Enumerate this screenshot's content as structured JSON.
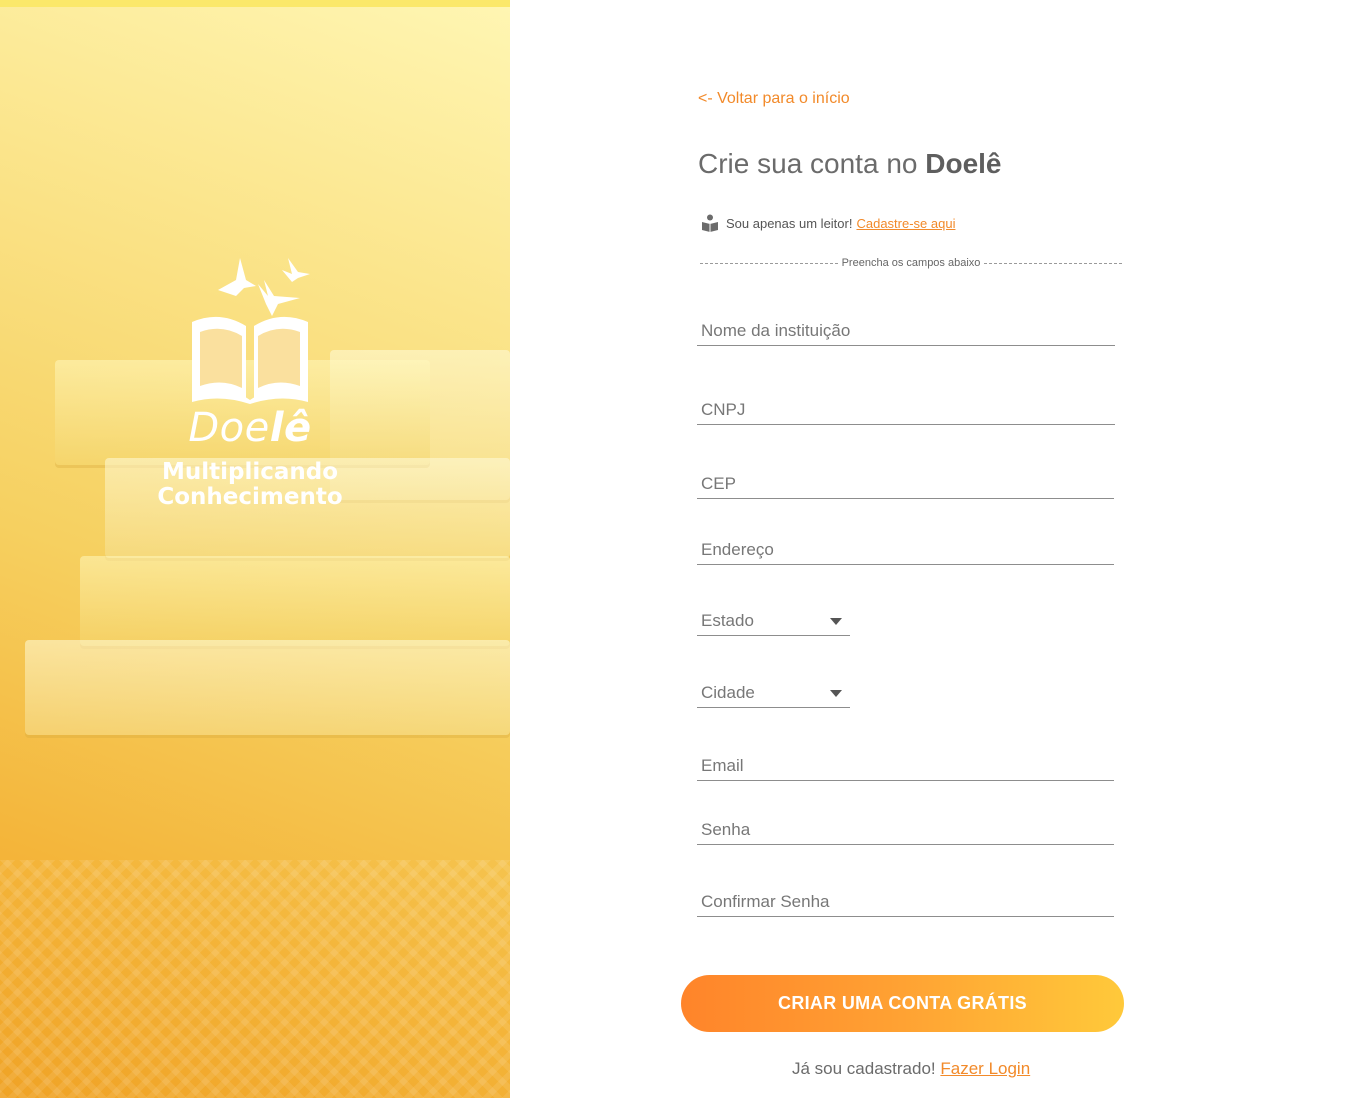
{
  "brand": {
    "name_regular": "Doe",
    "name_bold": "lê",
    "tagline": "Multiplicando\nConhecimento",
    "logo_icon": "book-with-birds-icon"
  },
  "nav": {
    "back_label": "<- Voltar para o início"
  },
  "header": {
    "title_prefix": "Crie sua conta no ",
    "title_brand": "Doelê"
  },
  "reader": {
    "icon": "reader-person-icon",
    "text": "Sou apenas um leitor!",
    "link_label": "Cadastre-se aqui"
  },
  "divider": {
    "text": "Preencha os campos abaixo"
  },
  "form": {
    "institution_label": "Nome da instituição",
    "cnpj_label": "CNPJ",
    "cep_label": "CEP",
    "address_label": "Endereço",
    "state_label": "Estado",
    "city_label": "Cidade",
    "email_label": "Email",
    "password_label": "Senha",
    "confirm_password_label": "Confirmar Senha",
    "submit_label": "CRIAR UMA CONTA GRÁTIS"
  },
  "login": {
    "text": "Já sou cadastrado!",
    "link_label": "Fazer Login"
  },
  "colors": {
    "accent": "#f28a2a",
    "button_gradient_start": "#ff842a",
    "button_gradient_end": "#ffc93a",
    "hero_yellow": "#f6d060"
  }
}
